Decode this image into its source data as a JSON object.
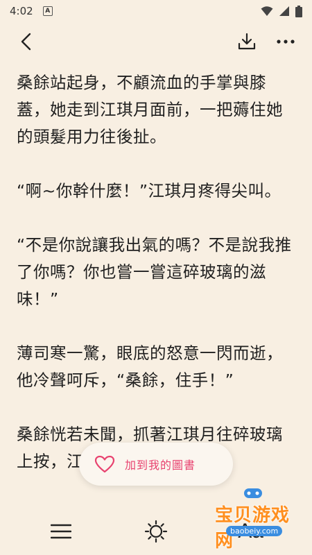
{
  "status": {
    "time": "4:02",
    "a_badge": "A"
  },
  "toolbar": {
    "back_icon": "chevron-left-icon",
    "download_icon": "download-icon",
    "more_icon": "more-horizontal-icon"
  },
  "content": {
    "paragraphs": [
      "桑餘站起身，不顧流血的手掌與膝蓋，她走到江琪月面前，一把薅住她的頭髮用力往後扯。",
      "“啊~你幹什麼！”江琪月疼得尖叫。",
      "“不是你說讓我出氣的嗎？不是說我推了你嗎？你也嘗一嘗這碎玻璃的滋味！”",
      "薄司寒一驚，眼底的怒意一閃而逝，他冷聲呵斥，“桑餘，住手！”",
      "桑餘恍若未聞，抓著江琪月往碎玻璃上按，江琪月不停的掙扎哭"
    ]
  },
  "add_pill": {
    "label": "加到我的圖書",
    "icon": "heart-icon",
    "color": "#e8426f"
  },
  "bottom_bar": {
    "menu_icon": "menu-icon",
    "brightness_icon": "sun-icon",
    "font_label": "Aa"
  },
  "watermark": {
    "text": "宝贝游戏网",
    "url": "baobeiy.com"
  }
}
